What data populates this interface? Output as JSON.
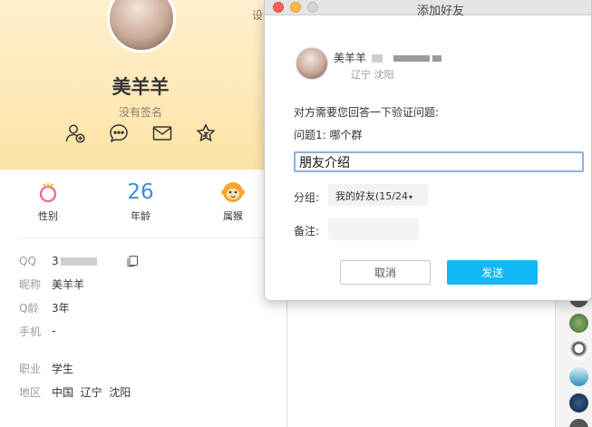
{
  "profile": {
    "name": "美羊羊",
    "signature": "没有签名",
    "settings_label": "设",
    "tags": [
      {
        "label": "性别",
        "icon": "female-icon"
      },
      {
        "label": "年龄",
        "value": "26"
      },
      {
        "label": "属猴",
        "icon": "monkey-icon"
      }
    ],
    "info": {
      "qq_label": "QQ",
      "qq_value": "3",
      "nickname_label": "昵称",
      "nickname_value": "美羊羊",
      "qage_label": "Q龄",
      "qage_value": "3年",
      "phone_label": "手机",
      "phone_value": "-",
      "job_label": "职业",
      "job_value": "学生",
      "region_label": "地区",
      "region_value": "中国  辽宁  沈阳"
    }
  },
  "dialog": {
    "title": "添加好友",
    "target_name": "美羊羊",
    "target_location": "辽宁 沈阳",
    "verify_prompt": "对方需要您回答一下验证问题:",
    "question": "问题1: 哪个群",
    "answer_value": "朋友介绍",
    "group_label": "分组:",
    "group_value": "我的好友(15/24",
    "remark_label": "备注:",
    "cancel_label": "取消",
    "send_label": "发送"
  },
  "colors": {
    "accent": "#12b7f5",
    "input_focus": "#8ab2e4",
    "age_blue": "#3d8bd6",
    "header_gold": "#fde3a5"
  }
}
